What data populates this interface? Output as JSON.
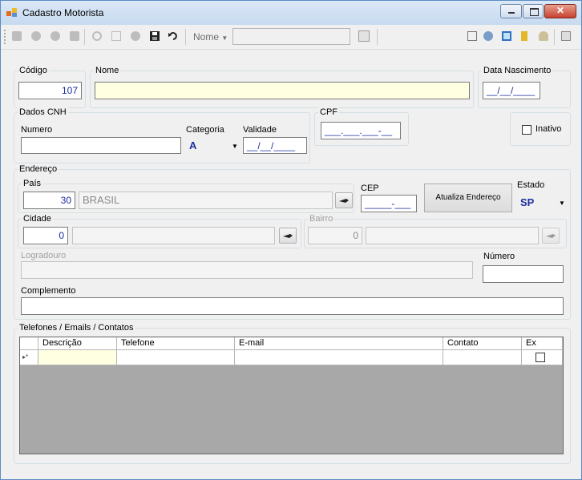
{
  "window": {
    "title": "Cadastro Motorista"
  },
  "toolbar": {
    "search_label": "Nome",
    "search_value": ""
  },
  "codigo": {
    "label": "Código",
    "value": "107"
  },
  "nome": {
    "label": "Nome",
    "value": ""
  },
  "nascimento": {
    "label": "Data Nascimento",
    "value": "__/__/____"
  },
  "cnh": {
    "group_label": "Dados CNH",
    "numero_label": "Numero",
    "numero_value": "",
    "categoria_label": "Categoria",
    "categoria_value": "A",
    "validade_label": "Validade",
    "validade_value": "__/__/____"
  },
  "cpf": {
    "label": "CPF",
    "value": "___.___.___-__"
  },
  "inativo": {
    "label": "Inativo",
    "checked": false
  },
  "endereco": {
    "group_label": "Endereço",
    "pais_label": "País",
    "pais_codigo": "30",
    "pais_nome": "BRASIL",
    "cep_label": "CEP",
    "cep_value": "_____-___",
    "atualiza_label": "Atualiza Endereço",
    "estado_label": "Estado",
    "estado_value": "SP",
    "cidade_label": "Cidade",
    "cidade_codigo": "0",
    "cidade_nome": "",
    "bairro_label": "Bairro",
    "bairro_codigo": "0",
    "bairro_nome": "",
    "logradouro_label": "Logradouro",
    "logradouro_value": "",
    "numero_label": "Número",
    "numero_value": "",
    "complemento_label": "Complemento",
    "complemento_value": ""
  },
  "contatos": {
    "group_label": "Telefones / Emails / Contatos",
    "columns": [
      "Descrição",
      "Telefone",
      "E-mail",
      "Contato",
      "Ex"
    ],
    "new_row_marker": "▸*"
  },
  "colors": {
    "accent_text": "#1c2ea0",
    "field_highlight": "#ffffe1"
  }
}
